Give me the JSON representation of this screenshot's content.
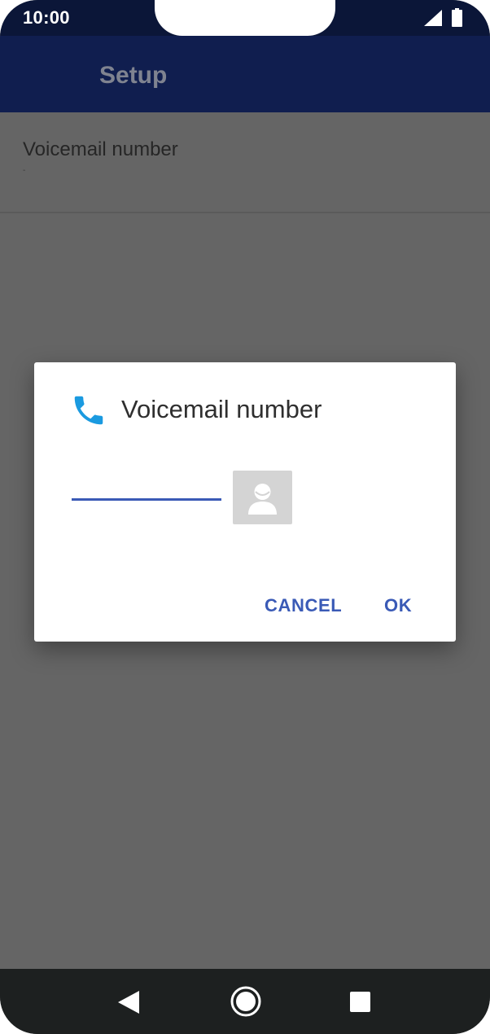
{
  "status_bar": {
    "time": "10:00",
    "icons": [
      "signal-icon",
      "battery-icon"
    ]
  },
  "app_bar": {
    "title": "Setup"
  },
  "preferences": [
    {
      "title": "Voicemail number",
      "summary": "-"
    }
  ],
  "dialog": {
    "icon": "phone-icon",
    "title": "Voicemail number",
    "input": {
      "value": "",
      "placeholder": ""
    },
    "contact_icon": "contact-person-icon",
    "cancel_label": "CANCEL",
    "ok_label": "OK"
  },
  "nav_bar": {
    "icons": [
      "back-icon",
      "home-icon",
      "recents-icon"
    ]
  },
  "colors": {
    "app_bar": "#101e4f",
    "status_bar": "#0b1638",
    "accent": "#3a5ab6",
    "phone_icon": "#1a9ae0",
    "scrim_background": "#656565",
    "nav_bar": "#1d2020"
  }
}
